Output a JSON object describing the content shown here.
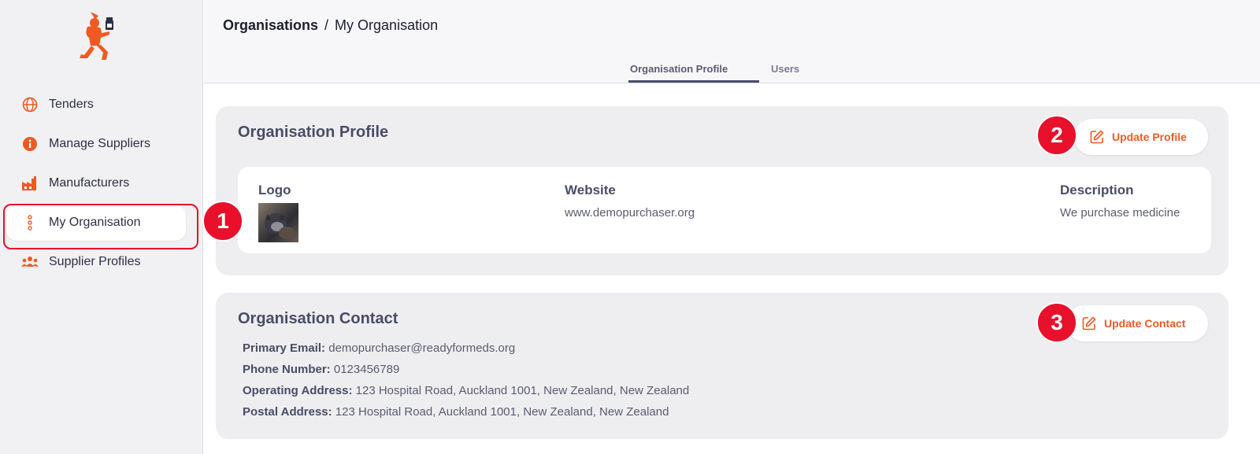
{
  "sidebar": {
    "items": [
      {
        "label": "Tenders",
        "icon": "globe-icon"
      },
      {
        "label": "Manage Suppliers",
        "icon": "info-icon"
      },
      {
        "label": "Manufacturers",
        "icon": "factory-icon"
      },
      {
        "label": "My Organisation",
        "icon": "dots-vertical-icon",
        "active": true
      },
      {
        "label": "Supplier Profiles",
        "icon": "users-icon"
      }
    ]
  },
  "breadcrumb": {
    "root": "Organisations",
    "separator": "/",
    "current": "My Organisation"
  },
  "tabs": [
    {
      "label": "Organisation Profile",
      "active": true
    },
    {
      "label": "Users",
      "active": false
    }
  ],
  "profile": {
    "title": "Organisation Profile",
    "update_label": "Update Profile",
    "logo_label": "Logo",
    "website_label": "Website",
    "website_value": "www.demopurchaser.org",
    "description_label": "Description",
    "description_value": "We purchase medicine"
  },
  "contact": {
    "title": "Organisation Contact",
    "update_label": "Update Contact",
    "primary_email_key": "Primary Email:",
    "primary_email": "demopurchaser@readyformeds.org",
    "phone_key": "Phone Number:",
    "phone": "0123456789",
    "operating_key": "Operating Address:",
    "operating_address": "123 Hospital Road, Auckland 1001, New Zealand, New Zealand",
    "postal_key": "Postal Address:",
    "postal_address": "123 Hospital Road, Auckland 1001, New Zealand, New Zealand"
  },
  "markers": [
    "1",
    "2",
    "3"
  ],
  "colors": {
    "accent": "#ef5a22",
    "callout": "#e8102a",
    "text_dark": "#2d2f45",
    "card_bg": "#eeeef1"
  }
}
